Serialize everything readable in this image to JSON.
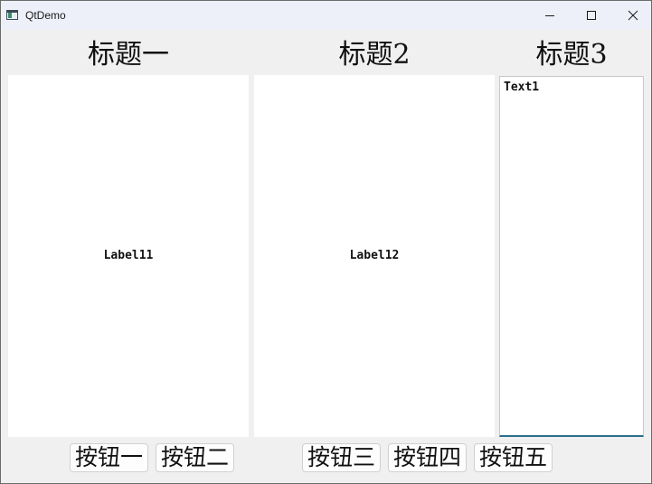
{
  "window": {
    "title": "QtDemo"
  },
  "headings": [
    "标题一",
    "标题2",
    "标题3"
  ],
  "panels": {
    "label1": "Label11",
    "label2": "Label12"
  },
  "textedit": {
    "value": "Text1"
  },
  "buttons": [
    "按钮一",
    "按钮二",
    "按钮三",
    "按钮四",
    "按钮五"
  ],
  "icons": {
    "app": "qt-app-icon",
    "minimize": "minimize-icon",
    "maximize": "maximize-icon",
    "close": "close-icon"
  },
  "colors": {
    "window_bg": "#f0f0f0",
    "titlebar_bg": "#eef0f9",
    "panel_bg": "#ffffff",
    "focus_accent": "#2b6f8a"
  }
}
